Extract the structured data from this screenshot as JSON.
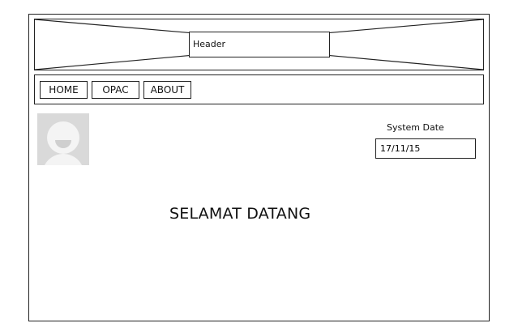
{
  "header": {
    "label": "Header"
  },
  "nav": {
    "items": [
      {
        "label": "HOME"
      },
      {
        "label": "OPAC"
      },
      {
        "label": "ABOUT"
      }
    ]
  },
  "avatar": {
    "icon": "user-placeholder-icon"
  },
  "system_date": {
    "label": "System Date",
    "value": "17/11/15"
  },
  "main": {
    "welcome": "SELAMAT DATANG"
  }
}
